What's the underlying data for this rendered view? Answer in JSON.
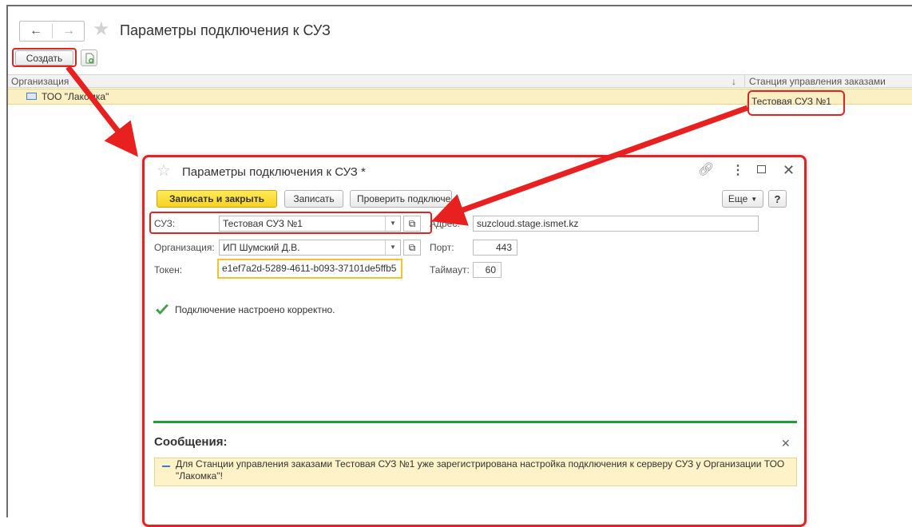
{
  "window": {
    "title": "Параметры подключения к СУЗ",
    "toolbar": {
      "create_label": "Создать"
    },
    "list": {
      "columns": [
        "Организация",
        "Станция управления заказами"
      ],
      "rows": [
        {
          "organization": "ТОО \"Лакомка\"",
          "station": "Тестовая СУЗ №1"
        }
      ]
    }
  },
  "dialog": {
    "title": "Параметры подключения к СУЗ *",
    "buttons": {
      "save_close": "Записать и закрыть",
      "save": "Записать",
      "check": "Проверить подключение",
      "more": "Еще",
      "help": "?"
    },
    "fields": {
      "suz_label": "СУЗ:",
      "suz_value": "Тестовая СУЗ №1",
      "org_label": "Организация:",
      "org_value": "ИП Шумский Д.В.",
      "token_label": "Токен:",
      "token_value": "e1ef7a2d-5289-4611-b093-37101de5ffb5",
      "address_label": "Адрес:",
      "address_value": "suzcloud.stage.ismet.kz",
      "port_label": "Порт:",
      "port_value": "443",
      "timeout_label": "Таймаут:",
      "timeout_value": "60"
    },
    "status_text": "Подключение настроено корректно.",
    "messages": {
      "title": "Сообщения:",
      "items": [
        "Для Станции управления заказами Тестовая СУЗ №1 уже зарегистрирована настройка подключения к серверу СУЗ у Организации ТОО \"Лакомка\"!"
      ]
    }
  },
  "colors": {
    "highlight": "#e52222",
    "primary_button": "#f7d31f",
    "selected_row": "#fbefc4",
    "separator_green": "#1f9e3a",
    "message_bg": "#fdf2c8"
  },
  "icons": [
    "back-arrow-icon",
    "forward-arrow-icon",
    "favorite-star-icon",
    "copy-document-icon",
    "organization-icon",
    "link-icon",
    "more-vertical-icon",
    "maximize-icon",
    "close-icon",
    "dropdown-arrow-icon",
    "open-icon",
    "success-check-icon"
  ]
}
